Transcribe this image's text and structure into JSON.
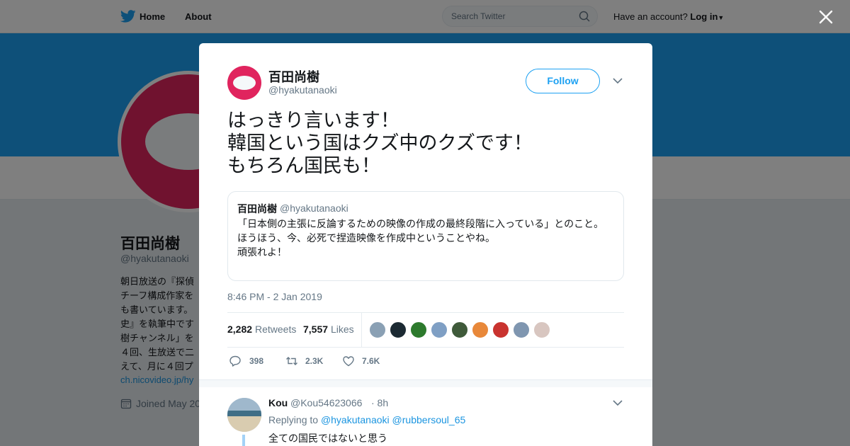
{
  "topbar": {
    "home_label": "Home",
    "about_label": "About",
    "search_placeholder": "Search Twitter",
    "have_account": "Have an account?",
    "login_label": "Log in",
    "brand_color": "#1da1f2"
  },
  "profile": {
    "name": "百田尚樹",
    "handle": "@hyakutanaoki",
    "bio_visible": "朝日放送の『探偵\nチーフ構成作家を\nも書いています。\n史』を執筆中です\n樹チャンネル」を\n４回、生放送で二\nえて、月に４回プ",
    "link": "ch.nicovideo.jp/hy",
    "joined": "Joined May 20",
    "avatar_color": "#e0245e"
  },
  "tweet": {
    "author_name": "百田尚樹",
    "author_handle": "@hyakutanaoki",
    "follow_label": "Follow",
    "text": "はっきり言います！\n韓国という国はクズ中のクズです！\nもちろん国民も！",
    "quote": {
      "name": "百田尚樹",
      "handle": "@hyakutanaoki",
      "text": "「日本側の主張に反論するための映像の作成の最終段階に入っている」とのこと。\nほうほう、今、必死で捏造映像を作成中ということやね。\n頑張れよ！"
    },
    "timestamp": "8:46 PM - 2 Jan 2019",
    "retweets_count": "2,282",
    "retweets_label": "Retweets",
    "likes_count": "7,557",
    "likes_label": "Likes",
    "liker_colors": [
      "#8aa0b4",
      "#1c2a33",
      "#2d7a2d",
      "#7f9fc4",
      "#3f5a3a",
      "#e8883a",
      "#c9332f",
      "#7f96b0",
      "#d8c6c0"
    ],
    "actions": {
      "reply_count": "398",
      "retweet_count": "2.3K",
      "like_count": "7.6K"
    }
  },
  "reply": {
    "name": "Kou",
    "handle": "@Kou54623066",
    "time": "· 8h",
    "replying_prefix": "Replying to",
    "mention1": "@hyakutanaoki",
    "mention2": "@rubbersoul_65",
    "text": "全ての国民ではないと思う"
  }
}
